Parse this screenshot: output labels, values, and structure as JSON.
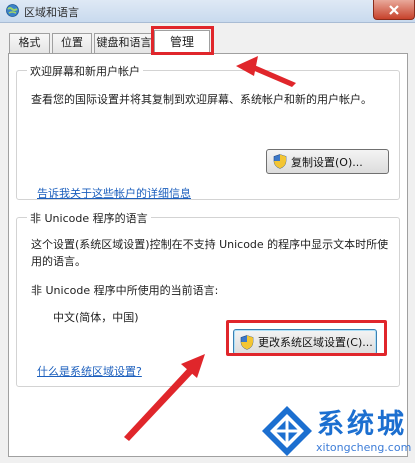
{
  "window": {
    "title": "区域和语言"
  },
  "tabs": [
    {
      "label": "格式"
    },
    {
      "label": "位置"
    },
    {
      "label": "键盘和语言"
    },
    {
      "label": "管理"
    }
  ],
  "welcome_group": {
    "legend": "欢迎屏幕和新用户帐户",
    "description": "查看您的国际设置并将其复制到欢迎屏幕、系统帐户和新的用户帐户。",
    "copy_button": "复制设置(O)...",
    "details_link": "告诉我关于这些帐户的详细信息"
  },
  "unicode_group": {
    "legend": "非 Unicode 程序的语言",
    "description_line1": "这个设置(系统区域设置)控制在不支持 Unicode 的程序中显示文本时所使",
    "description_line2": "用的语言。",
    "current_label": "非 Unicode 程序中所使用的当前语言:",
    "current_value": "中文(简体，中国)",
    "change_button": "更改系统区域设置(C)...",
    "help_link": "什么是系统区域设置?"
  },
  "watermark": {
    "title": "系统城",
    "url": "xitongcheng.com"
  },
  "colors": {
    "annotation_red": "#e0262b",
    "link_blue": "#1c5fbd",
    "watermark_blue": "#1c6fd0"
  }
}
